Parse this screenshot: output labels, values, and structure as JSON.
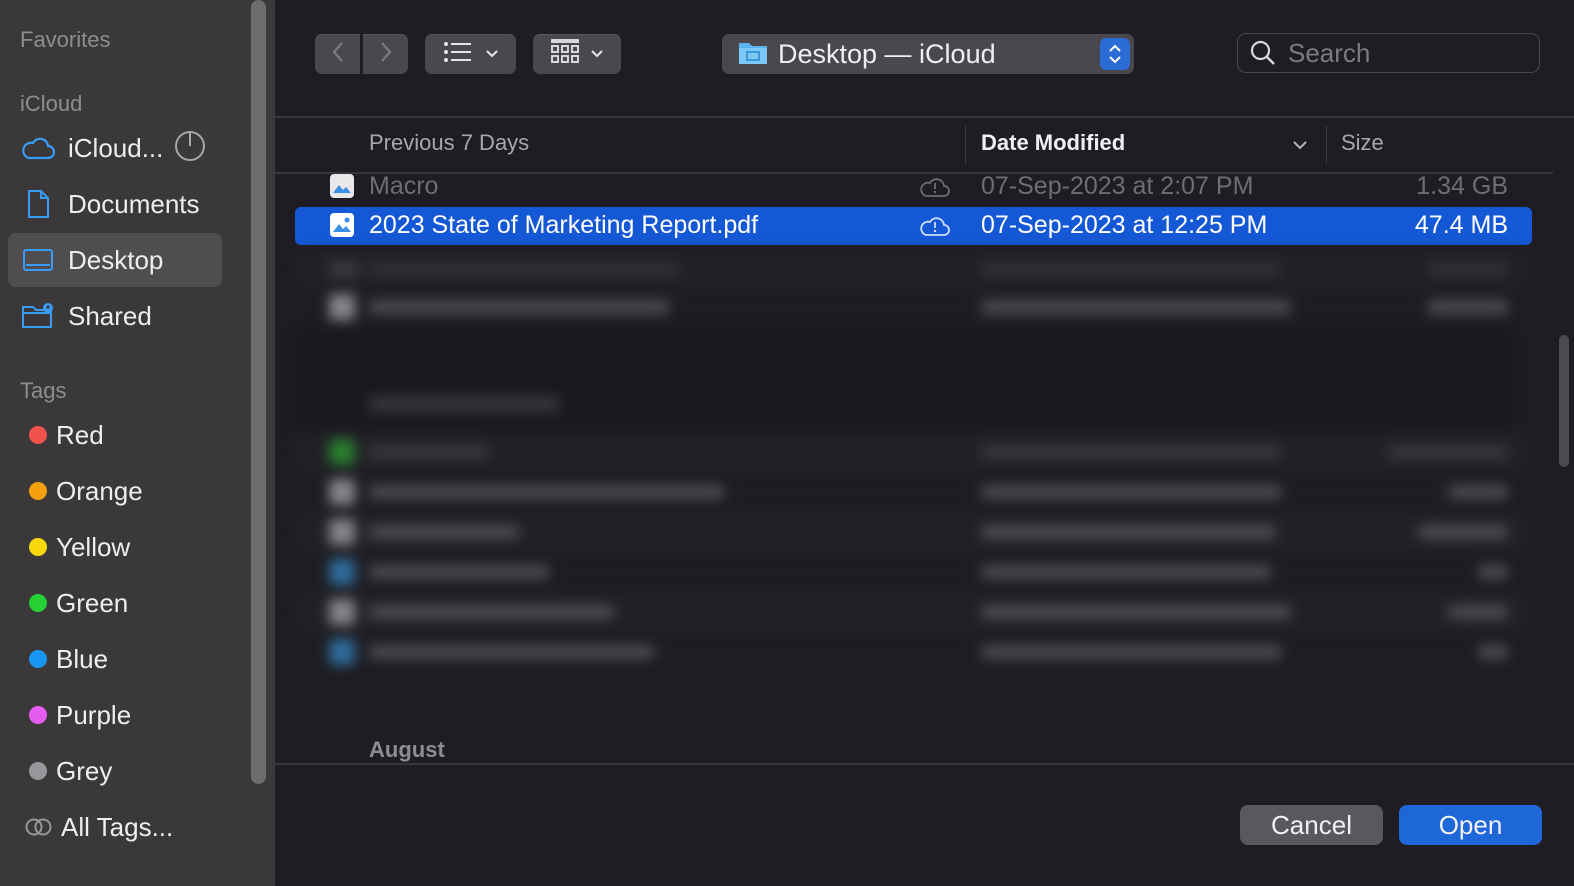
{
  "sidebar": {
    "sections": {
      "favorites": "Favorites",
      "icloud": "iCloud",
      "tags": "Tags"
    },
    "items": [
      {
        "label": "iCloud...",
        "icon": "cloud-icon"
      },
      {
        "label": "Documents",
        "icon": "document-icon"
      },
      {
        "label": "Desktop",
        "icon": "desktop-icon",
        "selected": true
      },
      {
        "label": "Shared",
        "icon": "shared-folder-icon"
      }
    ],
    "tags": [
      {
        "label": "Red",
        "color": "#f0534c"
      },
      {
        "label": "Orange",
        "color": "#f6a00f"
      },
      {
        "label": "Yellow",
        "color": "#f8d80b"
      },
      {
        "label": "Green",
        "color": "#27d034"
      },
      {
        "label": "Blue",
        "color": "#1a97f4"
      },
      {
        "label": "Purple",
        "color": "#e55df0"
      },
      {
        "label": "Grey",
        "color": "#98969b"
      },
      {
        "label": "All Tags..."
      }
    ]
  },
  "toolbar": {
    "location": "Desktop — iCloud",
    "search_placeholder": "Search"
  },
  "columns": {
    "name": "Previous 7 Days",
    "date": "Date Modified",
    "size": "Size"
  },
  "files": [
    {
      "name": "Macro",
      "date": "07-Sep-2023 at 2:07 PM",
      "size": "1.34 GB",
      "state": "dim"
    },
    {
      "name": "2023 State of Marketing Report.pdf",
      "date": "07-Sep-2023 at 12:25 PM",
      "size": "47.4 MB",
      "state": "selected"
    }
  ],
  "group_label_bottom": "August",
  "buttons": {
    "cancel": "Cancel",
    "open": "Open"
  },
  "colors": {
    "accent": "#1d67d8",
    "selection": "#1558d6"
  }
}
